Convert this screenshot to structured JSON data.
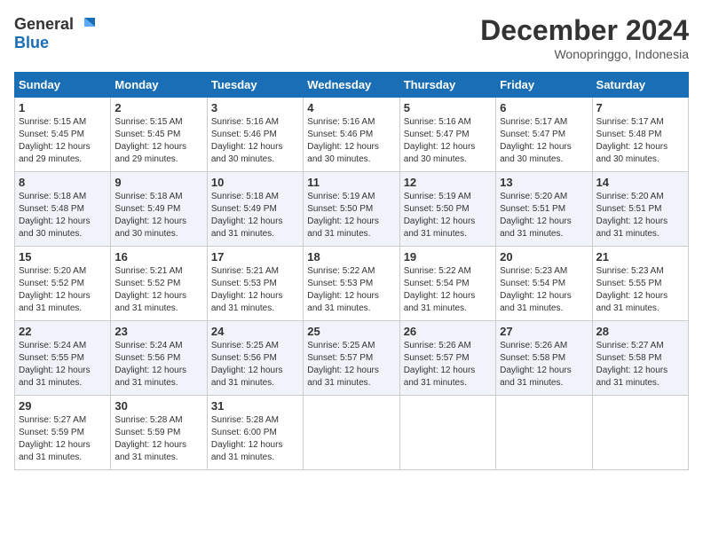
{
  "header": {
    "logo_general": "General",
    "logo_blue": "Blue",
    "month_title": "December 2024",
    "location": "Wonopringgo, Indonesia"
  },
  "days_of_week": [
    "Sunday",
    "Monday",
    "Tuesday",
    "Wednesday",
    "Thursday",
    "Friday",
    "Saturday"
  ],
  "weeks": [
    [
      {
        "day": "1",
        "sunrise": "Sunrise: 5:15 AM",
        "sunset": "Sunset: 5:45 PM",
        "daylight": "Daylight: 12 hours and 29 minutes."
      },
      {
        "day": "2",
        "sunrise": "Sunrise: 5:15 AM",
        "sunset": "Sunset: 5:45 PM",
        "daylight": "Daylight: 12 hours and 29 minutes."
      },
      {
        "day": "3",
        "sunrise": "Sunrise: 5:16 AM",
        "sunset": "Sunset: 5:46 PM",
        "daylight": "Daylight: 12 hours and 30 minutes."
      },
      {
        "day": "4",
        "sunrise": "Sunrise: 5:16 AM",
        "sunset": "Sunset: 5:46 PM",
        "daylight": "Daylight: 12 hours and 30 minutes."
      },
      {
        "day": "5",
        "sunrise": "Sunrise: 5:16 AM",
        "sunset": "Sunset: 5:47 PM",
        "daylight": "Daylight: 12 hours and 30 minutes."
      },
      {
        "day": "6",
        "sunrise": "Sunrise: 5:17 AM",
        "sunset": "Sunset: 5:47 PM",
        "daylight": "Daylight: 12 hours and 30 minutes."
      },
      {
        "day": "7",
        "sunrise": "Sunrise: 5:17 AM",
        "sunset": "Sunset: 5:48 PM",
        "daylight": "Daylight: 12 hours and 30 minutes."
      }
    ],
    [
      {
        "day": "8",
        "sunrise": "Sunrise: 5:18 AM",
        "sunset": "Sunset: 5:48 PM",
        "daylight": "Daylight: 12 hours and 30 minutes."
      },
      {
        "day": "9",
        "sunrise": "Sunrise: 5:18 AM",
        "sunset": "Sunset: 5:49 PM",
        "daylight": "Daylight: 12 hours and 30 minutes."
      },
      {
        "day": "10",
        "sunrise": "Sunrise: 5:18 AM",
        "sunset": "Sunset: 5:49 PM",
        "daylight": "Daylight: 12 hours and 31 minutes."
      },
      {
        "day": "11",
        "sunrise": "Sunrise: 5:19 AM",
        "sunset": "Sunset: 5:50 PM",
        "daylight": "Daylight: 12 hours and 31 minutes."
      },
      {
        "day": "12",
        "sunrise": "Sunrise: 5:19 AM",
        "sunset": "Sunset: 5:50 PM",
        "daylight": "Daylight: 12 hours and 31 minutes."
      },
      {
        "day": "13",
        "sunrise": "Sunrise: 5:20 AM",
        "sunset": "Sunset: 5:51 PM",
        "daylight": "Daylight: 12 hours and 31 minutes."
      },
      {
        "day": "14",
        "sunrise": "Sunrise: 5:20 AM",
        "sunset": "Sunset: 5:51 PM",
        "daylight": "Daylight: 12 hours and 31 minutes."
      }
    ],
    [
      {
        "day": "15",
        "sunrise": "Sunrise: 5:20 AM",
        "sunset": "Sunset: 5:52 PM",
        "daylight": "Daylight: 12 hours and 31 minutes."
      },
      {
        "day": "16",
        "sunrise": "Sunrise: 5:21 AM",
        "sunset": "Sunset: 5:52 PM",
        "daylight": "Daylight: 12 hours and 31 minutes."
      },
      {
        "day": "17",
        "sunrise": "Sunrise: 5:21 AM",
        "sunset": "Sunset: 5:53 PM",
        "daylight": "Daylight: 12 hours and 31 minutes."
      },
      {
        "day": "18",
        "sunrise": "Sunrise: 5:22 AM",
        "sunset": "Sunset: 5:53 PM",
        "daylight": "Daylight: 12 hours and 31 minutes."
      },
      {
        "day": "19",
        "sunrise": "Sunrise: 5:22 AM",
        "sunset": "Sunset: 5:54 PM",
        "daylight": "Daylight: 12 hours and 31 minutes."
      },
      {
        "day": "20",
        "sunrise": "Sunrise: 5:23 AM",
        "sunset": "Sunset: 5:54 PM",
        "daylight": "Daylight: 12 hours and 31 minutes."
      },
      {
        "day": "21",
        "sunrise": "Sunrise: 5:23 AM",
        "sunset": "Sunset: 5:55 PM",
        "daylight": "Daylight: 12 hours and 31 minutes."
      }
    ],
    [
      {
        "day": "22",
        "sunrise": "Sunrise: 5:24 AM",
        "sunset": "Sunset: 5:55 PM",
        "daylight": "Daylight: 12 hours and 31 minutes."
      },
      {
        "day": "23",
        "sunrise": "Sunrise: 5:24 AM",
        "sunset": "Sunset: 5:56 PM",
        "daylight": "Daylight: 12 hours and 31 minutes."
      },
      {
        "day": "24",
        "sunrise": "Sunrise: 5:25 AM",
        "sunset": "Sunset: 5:56 PM",
        "daylight": "Daylight: 12 hours and 31 minutes."
      },
      {
        "day": "25",
        "sunrise": "Sunrise: 5:25 AM",
        "sunset": "Sunset: 5:57 PM",
        "daylight": "Daylight: 12 hours and 31 minutes."
      },
      {
        "day": "26",
        "sunrise": "Sunrise: 5:26 AM",
        "sunset": "Sunset: 5:57 PM",
        "daylight": "Daylight: 12 hours and 31 minutes."
      },
      {
        "day": "27",
        "sunrise": "Sunrise: 5:26 AM",
        "sunset": "Sunset: 5:58 PM",
        "daylight": "Daylight: 12 hours and 31 minutes."
      },
      {
        "day": "28",
        "sunrise": "Sunrise: 5:27 AM",
        "sunset": "Sunset: 5:58 PM",
        "daylight": "Daylight: 12 hours and 31 minutes."
      }
    ],
    [
      {
        "day": "29",
        "sunrise": "Sunrise: 5:27 AM",
        "sunset": "Sunset: 5:59 PM",
        "daylight": "Daylight: 12 hours and 31 minutes."
      },
      {
        "day": "30",
        "sunrise": "Sunrise: 5:28 AM",
        "sunset": "Sunset: 5:59 PM",
        "daylight": "Daylight: 12 hours and 31 minutes."
      },
      {
        "day": "31",
        "sunrise": "Sunrise: 5:28 AM",
        "sunset": "Sunset: 6:00 PM",
        "daylight": "Daylight: 12 hours and 31 minutes."
      },
      null,
      null,
      null,
      null
    ]
  ]
}
